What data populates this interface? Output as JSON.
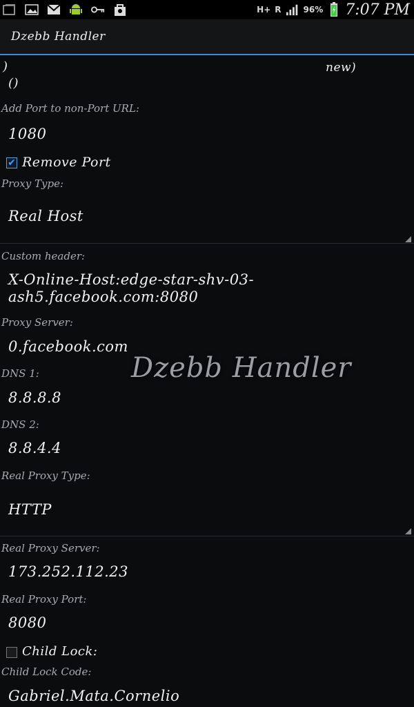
{
  "status_bar": {
    "network": "H+",
    "roaming": "R",
    "battery_percent": "96%",
    "time": "7:07 PM"
  },
  "title_bar": {
    "title": "Dzebb Handler"
  },
  "header_fragment": {
    "bracket": ")",
    "paren": "()",
    "new_label": "new)"
  },
  "form": {
    "add_port_label": "Add Port to non-Port URL:",
    "add_port_value": "1080",
    "remove_port_label": "Remove Port",
    "proxy_type_label": "Proxy Type:",
    "proxy_type_value": "Real Host",
    "custom_header_label": "Custom header:",
    "custom_header_line1": "X-Online-Host:edge-star-shv-03-",
    "custom_header_line2": "ash5.facebook.com:8080",
    "proxy_server_label": "Proxy Server:",
    "proxy_server_value": "0.facebook.com",
    "dns1_label": "DNS 1:",
    "dns1_value": "8.8.8.8",
    "dns2_label": "DNS 2:",
    "dns2_value": "8.8.4.4",
    "real_proxy_type_label": "Real Proxy Type:",
    "real_proxy_type_value": "HTTP",
    "real_proxy_server_label": "Real Proxy Server:",
    "real_proxy_server_value": "173.252.112.23",
    "real_proxy_port_label": "Real Proxy Port:",
    "real_proxy_port_value": "8080",
    "child_lock_label": "Child Lock:",
    "child_lock_code_label": "Child Lock Code:",
    "child_lock_code_value": "Gabriel.Mata.Cornelio"
  },
  "watermark": "Dzebb Handler",
  "icons": [
    "gallery-icon",
    "image-icon",
    "gmail-icon",
    "android-icon",
    "key-icon",
    "bag-icon",
    "signal-icon",
    "battery-icon"
  ]
}
